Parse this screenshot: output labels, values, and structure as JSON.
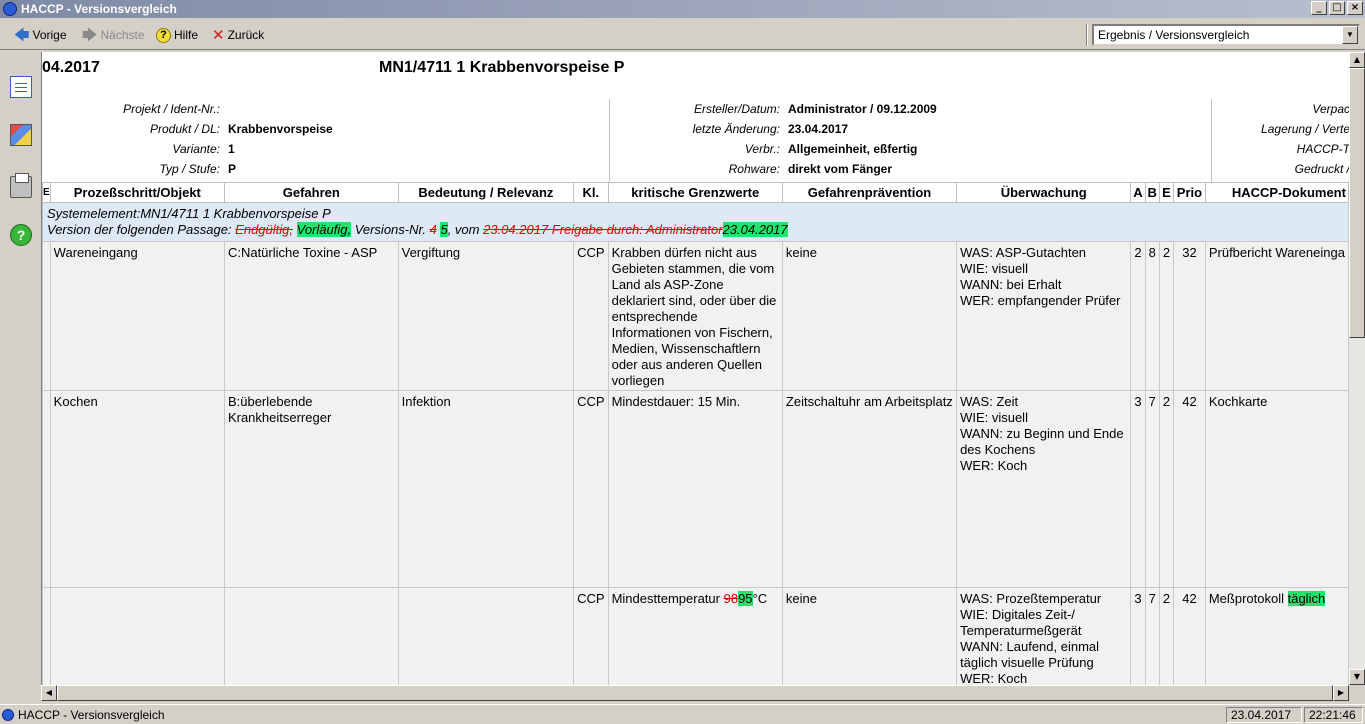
{
  "window": {
    "title": "HACCP - Versionsvergleich",
    "controls": [
      "_",
      "□",
      "×"
    ]
  },
  "toolbar": {
    "prev": "Vorige",
    "next": "Nächste",
    "help": "Hilfe",
    "back": "Zurück",
    "view_select": "Ergebnis / Versionsvergleich"
  },
  "header": {
    "date": "04.2017",
    "title": "MN1/4711 1 Krabbenvorspeise P"
  },
  "info_left": [
    {
      "label": "Projekt / Ident-Nr.:",
      "value": ""
    },
    {
      "label": "Produkt / DL:",
      "value": "Krabbenvorspeise"
    },
    {
      "label": "Variante:",
      "value": "1"
    },
    {
      "label": "Typ / Stufe:",
      "value": "P"
    }
  ],
  "info_mid": [
    {
      "label": "Ersteller/Datum:",
      "value": "Administrator / 09.12.2009"
    },
    {
      "label": "letzte Änderung:",
      "value": "23.04.2017"
    },
    {
      "label": "Verbr.:",
      "value": "Allgemeinheit, eßfertig"
    },
    {
      "label": "Rohware:",
      "value": "direkt vom Fänger"
    }
  ],
  "info_right": [
    "Verpac",
    "Lagerung / Verte",
    "HACCP-T",
    "Gedruckt /"
  ],
  "table": {
    "edge_col": "E",
    "headers": [
      "Prozeßschritt/Objekt",
      "Gefahren",
      "Bedeutung / Relevanz",
      "Kl.",
      "kritische Grenzwerte",
      "Gefahrenprävention",
      "Überwachung",
      "A",
      "B",
      "E",
      "Prio",
      "HACCP-Dokument"
    ],
    "system": {
      "line1": "Systemelement:MN1/4711 1 Krabbenvorspeise P",
      "l2_prefix": "Version der folgenden Passage:",
      "l2_status_old": "Endgültig,",
      "l2_status_new": "Vorläufig,",
      "l2_version_label": "Versions-Nr.",
      "l2_version_old": "4",
      "l2_version_new": "5",
      "l2_vom": ", vom",
      "l2_date_old": "23.04.2017 Freigabe durch: Administrator",
      "l2_date_new": "23.04.2017"
    },
    "rows": [
      {
        "step": "Wareneingang",
        "hazard": "C:Natürliche Toxine - ASP",
        "relevance": "Vergiftung",
        "kl": "CCP",
        "limits": "Krabben dürfen nicht aus Gebieten stammen, die vom Land als ASP-Zone deklariert sind, oder über die entsprechende Informationen von Fischern, Medien, Wissenschaftlern oder aus anderen Quellen vorliegen",
        "prevention": "keine",
        "monitoring": [
          "WAS: ASP-Gutachten",
          "WIE: visuell",
          "WANN: bei Erhalt",
          "WER: empfangender Prüfer"
        ],
        "a": "2",
        "b": "8",
        "e": "2",
        "prio": "32",
        "doc": "Prüfbericht Wareneinga"
      },
      {
        "step": "Kochen",
        "hazard": "B:überlebende Krankheitserreger",
        "relevance": "Infektion",
        "kl": "CCP",
        "limits": "Mindestdauer: 15 Min.",
        "prevention": "Zeitschaltuhr am Arbeitsplatz",
        "monitoring": [
          "WAS: Zeit",
          "WIE: visuell",
          "WANN: zu Beginn und Ende des Kochens",
          "WER: Koch"
        ],
        "a": "3",
        "b": "7",
        "e": "2",
        "prio": "42",
        "doc": "Kochkarte"
      },
      {
        "step": "",
        "hazard": "",
        "relevance": "",
        "kl": "CCP",
        "limits_prefix": "Mindesttemperatur",
        "limits_old": "98",
        "limits_new": "95",
        "limits_suffix": "°C",
        "prevention": "keine",
        "monitoring": [
          "WAS: Prozeßtemperatur",
          "WIE: Digitales Zeit-/ Temperaturmeßgerät",
          "WANN: Laufend, einmal täglich visuelle Prüfung",
          "WER: Koch"
        ],
        "a": "3",
        "b": "7",
        "e": "2",
        "prio": "42",
        "doc": "Meßprotokoll",
        "doc_new": "täglich"
      }
    ]
  },
  "taskbar": {
    "app": "HACCP - Versionsvergleich",
    "date": "23.04.2017",
    "time": "22:21:46"
  }
}
